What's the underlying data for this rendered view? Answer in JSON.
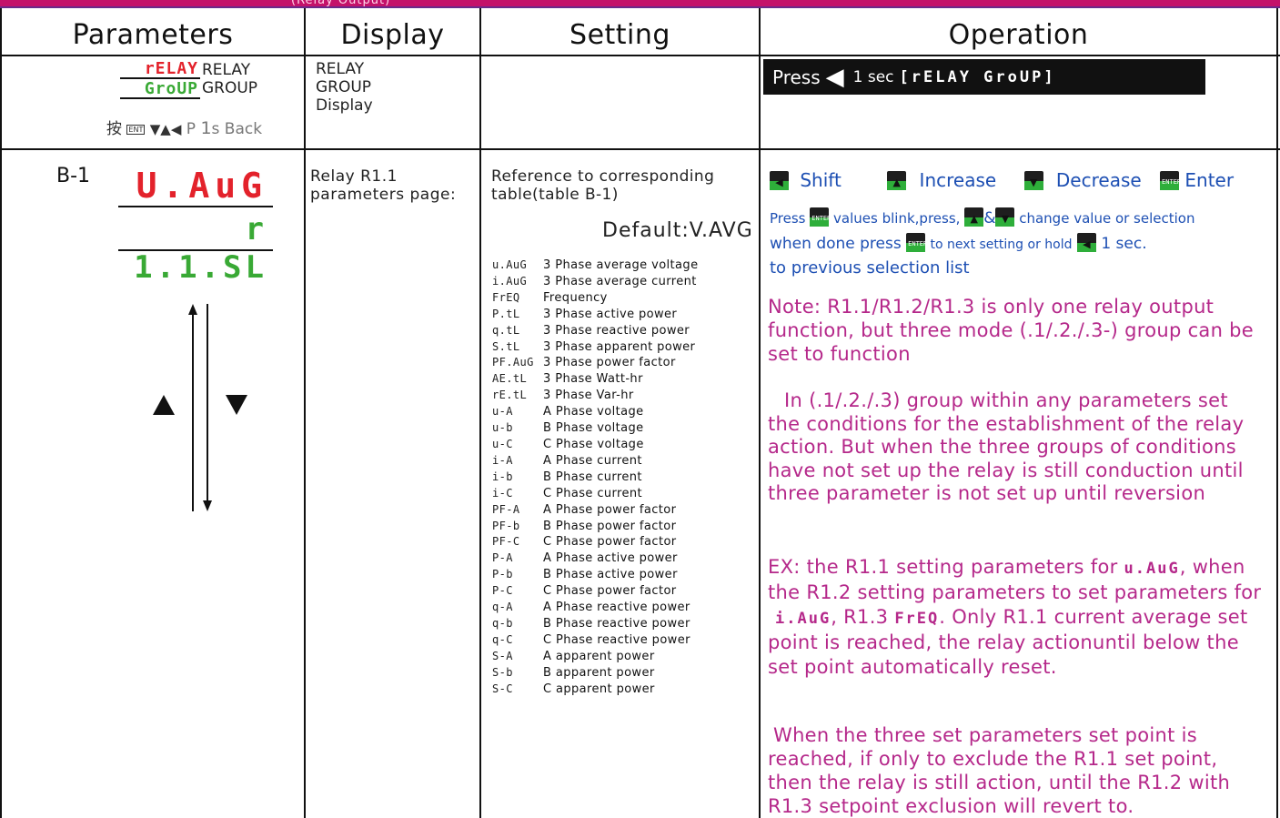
{
  "header_bar": {
    "fragment": "(Relay Output)"
  },
  "columns": {
    "parameters": "Parameters",
    "display": "Display",
    "setting": "Setting",
    "operation": "Operation"
  },
  "row1": {
    "seg_top": "rELAY",
    "seg_bottom": "GroUP",
    "label_top": "RELAY",
    "label_bottom": "GROUP",
    "nav_prefix": "按",
    "nav_ent": "ENT",
    "nav_arrows": "▼▲◀",
    "nav_p": "P",
    "nav_one": "1",
    "nav_back": "s Back",
    "display_lines": [
      "RELAY",
      "GROUP",
      "Display"
    ],
    "operation": {
      "press": "Press",
      "sec": "1 sec",
      "seg": "[rELAY GroUP]"
    }
  },
  "row2": {
    "id": "B-1",
    "seg_top": "U.AuG",
    "seg_bottom": "r 1.1.SL",
    "display_lines": [
      "Relay R1.1",
      "parameters page:"
    ],
    "setting_intro": [
      "Reference to corresponding",
      "table(table B-1)"
    ],
    "default_label": "Default",
    "default_value": ":V.AVG",
    "list": [
      {
        "code": "u.AuG",
        "desc": "3 Phase average voltage"
      },
      {
        "code": "i.AuG",
        "desc": "3 Phase average current"
      },
      {
        "code": "FrEQ",
        "desc": "Frequency"
      },
      {
        "code": "P.tL",
        "desc": "3 Phase active power"
      },
      {
        "code": "q.tL",
        "desc": "3 Phase reactive power"
      },
      {
        "code": "S.tL",
        "desc": "3 Phase apparent power"
      },
      {
        "code": "PF.AuG",
        "desc": "3 Phase power factor"
      },
      {
        "code": "AE.tL",
        "desc": "3 Phase Watt-hr"
      },
      {
        "code": "rE.tL",
        "desc": "3 Phase Var-hr"
      },
      {
        "code": "u-A",
        "desc": "A Phase voltage"
      },
      {
        "code": "u-b",
        "desc": "B Phase voltage"
      },
      {
        "code": "u-C",
        "desc": "C Phase voltage"
      },
      {
        "code": "i-A",
        "desc": "A Phase current"
      },
      {
        "code": "i-b",
        "desc": "B Phase current"
      },
      {
        "code": "i-C",
        "desc": "C Phase current"
      },
      {
        "code": "PF-A",
        "desc": "A Phase power factor"
      },
      {
        "code": "PF-b",
        "desc": "B Phase power factor"
      },
      {
        "code": "PF-C",
        "desc": "C Phase power factor"
      },
      {
        "code": "P-A",
        "desc": "A Phase active power"
      },
      {
        "code": "P-b",
        "desc": "B Phase active power"
      },
      {
        "code": "P-C",
        "desc": "C Phase power factor"
      },
      {
        "code": "q-A",
        "desc": "A Phase reactive power"
      },
      {
        "code": "q-b",
        "desc": "B Phase reactive power"
      },
      {
        "code": "q-C",
        "desc": "C Phase reactive power"
      },
      {
        "code": "S-A",
        "desc": "A apparent power"
      },
      {
        "code": "S-b",
        "desc": "B apparent power"
      },
      {
        "code": "S-C",
        "desc": "C apparent power"
      }
    ],
    "ops": {
      "shift": "Shift",
      "increase": "Increase",
      "decrease": "Decrease",
      "enter": "Enter",
      "line1_a": "Press",
      "line1_b": "values blink,press,",
      "line1_c": "&",
      "line1_d": "change value or selection",
      "line2_a": "when done press",
      "line2_b": "to next setting or hold",
      "line2_c": "1 sec.",
      "line3": "to previous selection list"
    },
    "note": "Note: R1.1/R1.2/R1.3 is only one relay output function, but three mode (.1/.2./.3-) group can be set to function",
    "para2": "In (.1/.2./.3) group within any parameters set the conditions for the establishment of the relay action. But when the three groups of conditions have not set up the relay is still conduction until three parameter is not set up until reversion",
    "ex": {
      "a": "EX: the R1.1 setting parameters for",
      "seg1": "u.AuG",
      "b": ",",
      "c": "when the R1.2 setting parameters to set parameters for",
      "seg2": "i.AuG",
      "d": ", R1.3",
      "seg3": "FrEQ",
      "e": ". Only R1.1 current average set point is reached, the relay actionuntil below the set point automatically reset."
    },
    "para4": "When the three set parameters set point is reached, if only to exclude the R1.1 set point, then the relay is still action, until the R1.2 with R1.3 setpoint exclusion will revert to."
  },
  "colors": {
    "magenta": "#b5288a",
    "blue": "#1d4fb3",
    "led_red": "#e3222b",
    "led_green": "#39a935"
  }
}
